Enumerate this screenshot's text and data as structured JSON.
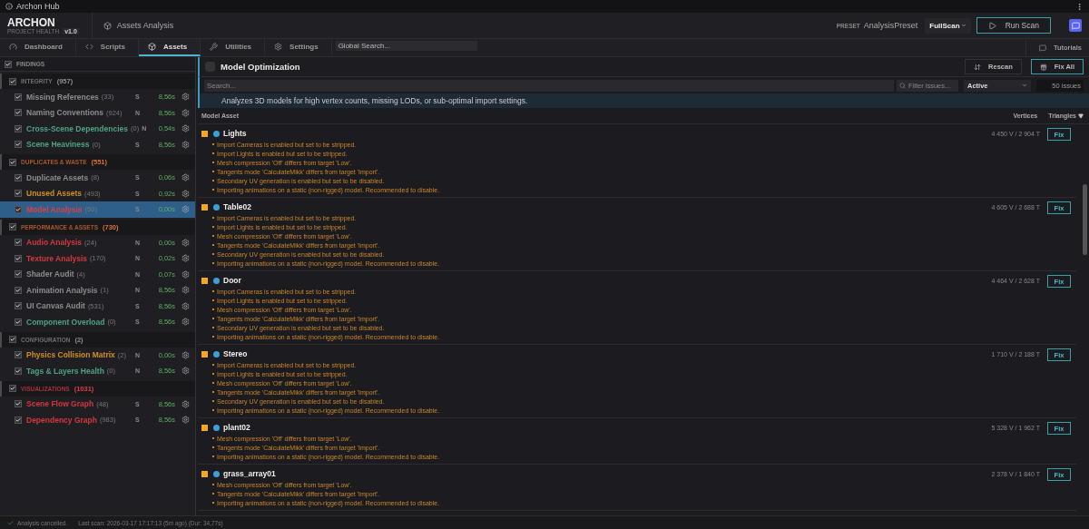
{
  "titlebar": {
    "title": "Archon Hub"
  },
  "header": {
    "brand": "ARCHON",
    "subtitle": "PROJECT HEALTH",
    "version": "v1.0",
    "breadcrumb": "Assets Analysis",
    "preset_label": "PRESET",
    "preset": "AnalysisPreset",
    "scan_mode": "FullScan",
    "run_button": "Run Scan"
  },
  "tabs": [
    {
      "label": "Dashboard",
      "selected": false
    },
    {
      "label": "Scripts",
      "selected": false
    },
    {
      "label": "Assets",
      "selected": true
    },
    {
      "label": "Utilities",
      "selected": false
    },
    {
      "label": "Settings",
      "selected": false
    }
  ],
  "global_search": {
    "placeholder": "Global Search..."
  },
  "tutorials_button": "Tutorials",
  "sidebar": {
    "title": "FINDINGS",
    "checked": true,
    "groups": [
      {
        "label": "INTEGRITY",
        "count": "(957)",
        "color": "#6e6e6e",
        "checked": true,
        "items": [
          {
            "name": "Missing References",
            "count": "(33)",
            "mode": "S",
            "time": "8,56s",
            "color": "#8c8c8c",
            "checked": true,
            "selected": false
          },
          {
            "name": "Naming Conventions",
            "count": "(924)",
            "mode": "N",
            "time": "8,56s",
            "color": "#8c8c8c",
            "checked": true,
            "selected": false
          },
          {
            "name": "Cross-Scene Dependencies",
            "count": "(0)",
            "mode": "N",
            "time": "0,54s",
            "color": "#4fa184",
            "checked": true,
            "selected": false
          },
          {
            "name": "Scene Heaviness",
            "count": "(0)",
            "mode": "S",
            "time": "8,56s",
            "color": "#4fa184",
            "checked": true,
            "selected": false
          }
        ]
      },
      {
        "label": "DUPLICATES & WASTE",
        "count": "(551)",
        "color": "#a8582c",
        "checked": true,
        "items": [
          {
            "name": "Duplicate Assets",
            "count": "(8)",
            "mode": "S",
            "time": "0,06s",
            "color": "#8c8c8c",
            "checked": true,
            "selected": false
          },
          {
            "name": "Unused Assets",
            "count": "(493)",
            "mode": "S",
            "time": "0,92s",
            "color": "#d0901e",
            "checked": true,
            "selected": false
          },
          {
            "name": "Model Analysis",
            "count": "(50)",
            "mode": "S",
            "time": "0,00s",
            "color": "#d8404a",
            "checked": true,
            "selected": true
          }
        ]
      },
      {
        "label": "PERFORMANCE & ASSETS",
        "count": "(730)",
        "color": "#a8582c",
        "checked": true,
        "items": [
          {
            "name": "Audio Analysis",
            "count": "(24)",
            "mode": "N",
            "time": "0,00s",
            "color": "#d0383e",
            "checked": true,
            "selected": false
          },
          {
            "name": "Texture Analysis",
            "count": "(170)",
            "mode": "N",
            "time": "0,02s",
            "color": "#d0383e",
            "checked": true,
            "selected": false
          },
          {
            "name": "Shader Audit",
            "count": "(4)",
            "mode": "N",
            "time": "0,07s",
            "color": "#8c8c8c",
            "checked": true,
            "selected": false
          },
          {
            "name": "Animation Analysis",
            "count": "(1)",
            "mode": "N",
            "time": "8,56s",
            "color": "#8c8c8c",
            "checked": true,
            "selected": false
          },
          {
            "name": "UI Canvas Audit",
            "count": "(531)",
            "mode": "S",
            "time": "8,56s",
            "color": "#8c8c8c",
            "checked": true,
            "selected": false
          },
          {
            "name": "Component Overload",
            "count": "(0)",
            "mode": "S",
            "time": "8,56s",
            "color": "#4fa184",
            "checked": true,
            "selected": false
          }
        ]
      },
      {
        "label": "CONFIGURATION",
        "count": "(2)",
        "color": "#6e6e6e",
        "checked": true,
        "items": [
          {
            "name": "Physics Collision Matrix",
            "count": "(2)",
            "mode": "N",
            "time": "0,00s",
            "color": "#d0901e",
            "checked": true,
            "selected": false
          },
          {
            "name": "Tags & Layers Health",
            "count": "(0)",
            "mode": "N",
            "time": "8,56s",
            "color": "#4fa184",
            "checked": true,
            "selected": false
          }
        ]
      },
      {
        "label": "VISUALIZATIONS",
        "count": "(1031)",
        "color": "#a8303a",
        "checked": true,
        "items": [
          {
            "name": "Scene Flow Graph",
            "count": "(48)",
            "mode": "S",
            "time": "8,56s",
            "color": "#d0383e",
            "checked": true,
            "selected": false
          },
          {
            "name": "Dependency Graph",
            "count": "(983)",
            "mode": "S",
            "time": "8,56s",
            "color": "#d0383e",
            "checked": true,
            "selected": false
          }
        ]
      }
    ]
  },
  "panel": {
    "title": "Model Optimization",
    "rescan_button": "Rescan",
    "fix_all_button": "Fix All",
    "search": {
      "placeholder": "Search..."
    },
    "filter": {
      "placeholder": "Filter issues..."
    },
    "status_filter": "Active",
    "issue_count": "50 issues",
    "description": "Analyzes 3D models for high vertex counts, missing LODs, or sub-optimal import settings.",
    "columns": [
      "Model Asset",
      "Vertices",
      "Triangles"
    ],
    "rows": [
      {
        "name": "Lights",
        "stats": "4 450 V / 2 904 T",
        "color": "#f5a623",
        "fix": "Fix",
        "issues": [
          "Import Cameras is enabled but set to be stripped.",
          "Import Lights is enabled but set to be stripped.",
          "Mesh compression 'Off' differs from target 'Low'.",
          "Tangents mode 'CalculateMikk' differs from target 'Import'.",
          "Secondary UV generation is enabled but set to be disabled.",
          "Importing animations on a static (non-rigged) model. Recommended to disable."
        ]
      },
      {
        "name": "Table02",
        "stats": "4 605 V / 2 688 T",
        "color": "#f5a623",
        "fix": "Fix",
        "issues": [
          "Import Cameras is enabled but set to be stripped.",
          "Import Lights is enabled but set to be stripped.",
          "Mesh compression 'Off' differs from target 'Low'.",
          "Tangents mode 'CalculateMikk' differs from target 'Import'.",
          "Secondary UV generation is enabled but set to be disabled.",
          "Importing animations on a static (non-rigged) model. Recommended to disable."
        ]
      },
      {
        "name": "Door",
        "stats": "4 464 V / 2 628 T",
        "color": "#f5a623",
        "fix": "Fix",
        "issues": [
          "Import Cameras is enabled but set to be stripped.",
          "Import Lights is enabled but set to be stripped.",
          "Mesh compression 'Off' differs from target 'Low'.",
          "Tangents mode 'CalculateMikk' differs from target 'Import'.",
          "Secondary UV generation is enabled but set to be disabled.",
          "Importing animations on a static (non-rigged) model. Recommended to disable."
        ]
      },
      {
        "name": "Stereo",
        "stats": "1 710 V / 2 188 T",
        "color": "#f5a623",
        "fix": "Fix",
        "issues": [
          "Import Cameras is enabled but set to be stripped.",
          "Import Lights is enabled but set to be stripped.",
          "Mesh compression 'Off' differs from target 'Low'.",
          "Tangents mode 'CalculateMikk' differs from target 'Import'.",
          "Secondary UV generation is enabled but set to be disabled.",
          "Importing animations on a static (non-rigged) model. Recommended to disable."
        ]
      },
      {
        "name": "plant02",
        "stats": "5 328 V / 1 962 T",
        "color": "#f5a623",
        "fix": "Fix",
        "issues": [
          "Mesh compression 'Off' differs from target 'Low'.",
          "Tangents mode 'CalculateMikk' differs from target 'Import'.",
          "Importing animations on a static (non-rigged) model. Recommended to disable."
        ]
      },
      {
        "name": "grass_array01",
        "stats": "2 378 V / 1 840 T",
        "color": "#f5a623",
        "fix": "Fix",
        "issues": [
          "Mesh compression 'Off' differs from target 'Low'.",
          "Tangents mode 'CalculateMikk' differs from target 'Import'.",
          "Importing animations on a static (non-rigged) model. Recommended to disable."
        ]
      }
    ]
  },
  "status_bar": {
    "message": "Analysis cancelled.",
    "last_scan": "Last scan: 2026-03-17 17:17:13 (5m ago) (Dur: 34,77s)"
  }
}
